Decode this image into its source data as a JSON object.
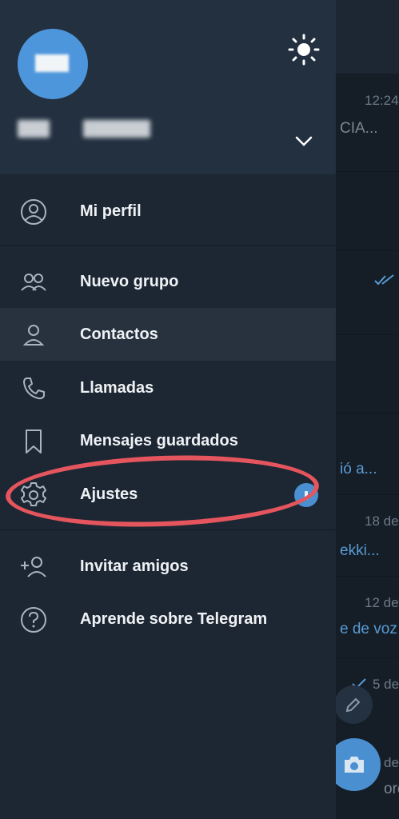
{
  "background_chats": {
    "times": [
      "12:24",
      "18 de",
      "12 de",
      "5 de",
      "de"
    ],
    "previews": [
      "CIA...",
      "ió a...",
      "ekki...",
      "e de voz",
      "ore"
    ]
  },
  "drawer": {
    "theme_toggle_icon": "sun-icon",
    "account_switch_icon": "chevron-down-icon",
    "menu": [
      {
        "label": "Mi perfil",
        "icon": "profile-circle-icon"
      },
      {
        "label": "Nuevo grupo",
        "icon": "group-icon"
      },
      {
        "label": "Contactos",
        "icon": "contact-icon"
      },
      {
        "label": "Llamadas",
        "icon": "phone-icon"
      },
      {
        "label": "Mensajes guardados",
        "icon": "bookmark-icon"
      },
      {
        "label": "Ajustes",
        "icon": "gear-icon"
      },
      {
        "label": "Invitar amigos",
        "icon": "add-user-icon"
      },
      {
        "label": "Aprende sobre Telegram",
        "icon": "help-circle-icon"
      }
    ]
  },
  "colors": {
    "drawer_bg": "#1d2733",
    "header_bg": "#233040",
    "accent": "#4e96dc",
    "annotation_ring": "#e4555d"
  }
}
